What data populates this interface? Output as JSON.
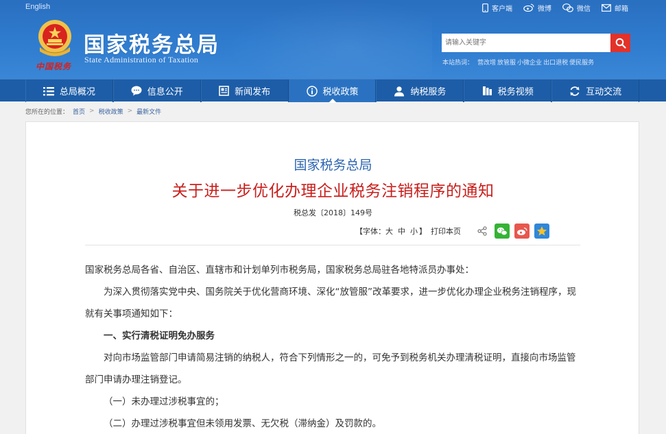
{
  "header": {
    "lang_link": "English",
    "top_links": [
      {
        "label": "客户端",
        "icon": "phone-icon"
      },
      {
        "label": "微博",
        "icon": "weibo-icon"
      },
      {
        "label": "微信",
        "icon": "wechat-icon"
      },
      {
        "label": "邮箱",
        "icon": "mail-icon"
      }
    ],
    "site_title": "国家税务总局",
    "site_subtitle": "State Administration of Taxation",
    "seal_text": "中国税务",
    "search_placeholder": "请输入关键字",
    "hot_label": "本站热词：",
    "hot_words": [
      "营改增",
      "放管服",
      "小微企业",
      "出口退税",
      "便民服务"
    ]
  },
  "nav": {
    "items": [
      {
        "label": "总局概况",
        "icon": "menu-icon"
      },
      {
        "label": "信息公开",
        "icon": "chat-bubble-icon"
      },
      {
        "label": "新闻发布",
        "icon": "newspaper-icon"
      },
      {
        "label": "税收政策",
        "icon": "info-icon"
      },
      {
        "label": "纳税服务",
        "icon": "user-icon"
      },
      {
        "label": "税务视频",
        "icon": "video-icon"
      },
      {
        "label": "互动交流",
        "icon": "refresh-icon"
      }
    ],
    "active_index": 3
  },
  "breadcrumb": {
    "prefix": "您所在的位置：",
    "items": [
      "首页",
      "税收政策",
      "最新文件"
    ]
  },
  "article": {
    "issuer": "国家税务总局",
    "title": "关于进一步优化办理企业税务注销程序的通知",
    "doc_number": "税总发〔2018〕149号",
    "font_label_open": "【字体：",
    "font_sizes": [
      "大",
      "中",
      "小"
    ],
    "font_label_close": "】",
    "print_label": "打印本页",
    "paragraphs": [
      {
        "style": "plain",
        "text": "国家税务总局各省、自治区、直辖市和计划单列市税务局，国家税务总局驻各地特派员办事处："
      },
      {
        "style": "indent",
        "text": "为深入贯彻落实党中央、国务院关于优化营商环境、深化“放管服”改革要求，进一步优化办理企业税务注销程序，现就有关事项通知如下："
      },
      {
        "style": "section",
        "text": "一、实行清税证明免办服务"
      },
      {
        "style": "indent",
        "text": "对向市场监管部门申请简易注销的纳税人，符合下列情形之一的，可免予到税务机关办理清税证明，直接向市场监管部门申请办理注销登记。"
      },
      {
        "style": "indent",
        "text": "（一）未办理过涉税事宜的；"
      },
      {
        "style": "indent",
        "text": "（二）办理过涉税事宜但未领用发票、无欠税（滞纳金）及罚款的。"
      }
    ]
  },
  "colors": {
    "header_blue": "#2f7ccf",
    "nav_blue": "#1d5da7",
    "title_red": "#c81f1c",
    "issuer_blue": "#2d65b0",
    "search_red": "#e2322a"
  }
}
